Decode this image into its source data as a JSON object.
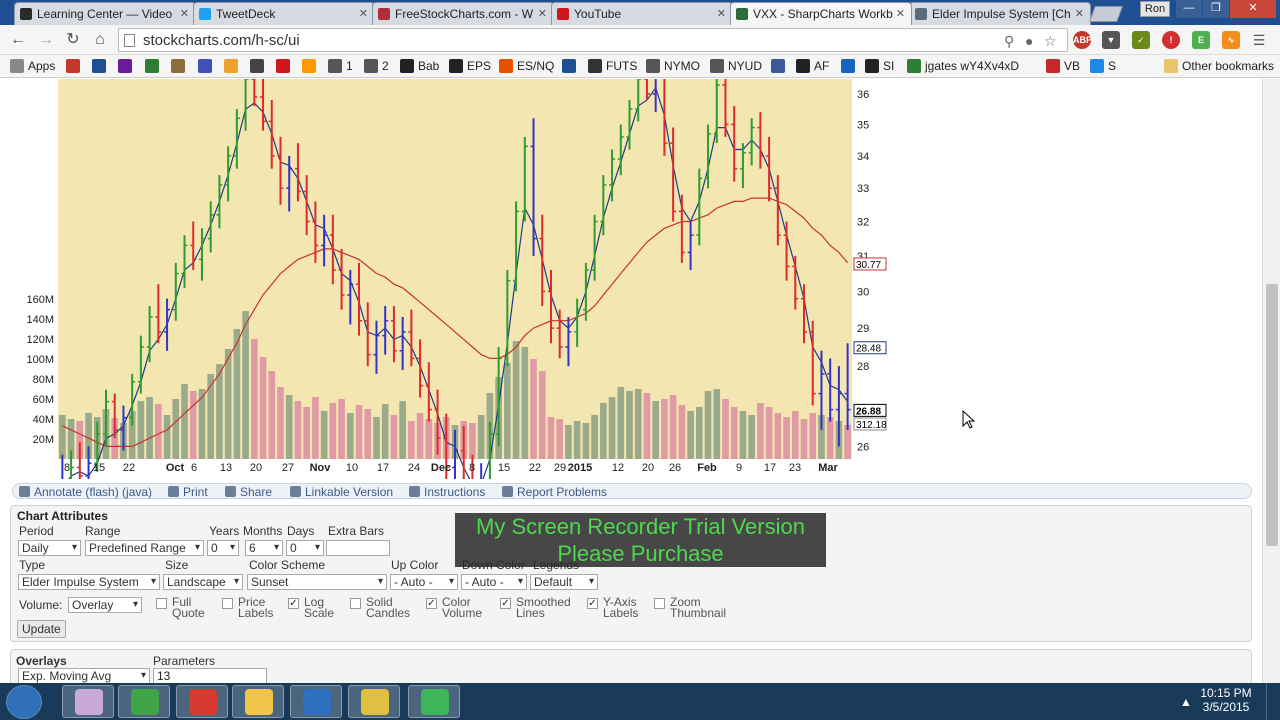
{
  "browser": {
    "tabs": [
      {
        "label": "Learning Center — Video",
        "color": "#2a2a2a"
      },
      {
        "label": "TweetDeck",
        "color": "#1da1f2"
      },
      {
        "label": "FreeStockCharts.com - W",
        "color": "#b0303a"
      },
      {
        "label": "YouTube",
        "color": "#cc181e"
      },
      {
        "label": "VXX - SharpCharts Workb",
        "color": "#2e6b3a"
      },
      {
        "label": "Elder Impulse System [Ch",
        "color": "#5a6b7a"
      }
    ],
    "active_tab": 4,
    "profile": "Ron",
    "url": "stockcharts.com/h-sc/ui"
  },
  "bookmarks": [
    {
      "label": "Apps",
      "color": "#888888"
    },
    {
      "label": "",
      "color": "#c0392b"
    },
    {
      "label": "",
      "color": "#1d4f91"
    },
    {
      "label": "",
      "color": "#6a1b9a"
    },
    {
      "label": "",
      "color": "#2e7d32"
    },
    {
      "label": "",
      "color": "#8a6d3b"
    },
    {
      "label": "",
      "color": "#3f51b5"
    },
    {
      "label": "",
      "color": "#f0a030"
    },
    {
      "label": "",
      "color": "#444444"
    },
    {
      "label": "",
      "color": "#cc181e"
    },
    {
      "label": "",
      "color": "#ff9800"
    },
    {
      "label": "1",
      "color": "#555555"
    },
    {
      "label": "2",
      "color": "#555555"
    },
    {
      "label": "Bab",
      "color": "#222222"
    },
    {
      "label": "EPS",
      "color": "#222222"
    },
    {
      "label": "ES/NQ",
      "color": "#e65100"
    },
    {
      "label": "",
      "color": "#1d4f91"
    },
    {
      "label": "FUTS",
      "color": "#333333"
    },
    {
      "label": "NYMO",
      "color": "#555555"
    },
    {
      "label": "NYUD",
      "color": "#555555"
    },
    {
      "label": "",
      "color": "#3b5998"
    },
    {
      "label": "AF",
      "color": "#222222"
    },
    {
      "label": "",
      "color": "#1565c0"
    },
    {
      "label": "SI",
      "color": "#222222"
    },
    {
      "label": "jgates wY4Xv4xD",
      "color": "#2e7d32"
    },
    {
      "label": "VB",
      "color": "#c62828"
    },
    {
      "label": "S",
      "color": "#1e88e5"
    }
  ],
  "other_bookmarks": "Other bookmarks",
  "chart_data": {
    "type": "bar",
    "style": "OHLC bars (Elder Impulse) with EMA overlays and volume",
    "x_ticks": [
      "8",
      "15",
      "22",
      "Oct",
      "6",
      "13",
      "20",
      "27",
      "Nov",
      "10",
      "17",
      "24",
      "Dec",
      "8",
      "15",
      "22",
      "29",
      "2015",
      "12",
      "20",
      "26",
      "Feb",
      "9",
      "17",
      "23",
      "Mar"
    ],
    "y_ticks_price": [
      "36",
      "35",
      "34",
      "33",
      "32",
      "31",
      "30",
      "29",
      "28",
      "26"
    ],
    "y_ticks_volume": [
      "160M",
      "140M",
      "120M",
      "100M",
      "80M",
      "60M",
      "40M",
      "20M"
    ],
    "y_scale": "log",
    "last_labels": [
      "30.77",
      "28.48",
      "26.88",
      "312.18"
    ],
    "colors": {
      "up": "#2e9d2e",
      "down": "#dd2a2a",
      "neutral": "#3333cc",
      "ema_fast": "#1f3a8a",
      "ema_slow": "#c83232",
      "vol_up": "#9aaa8a",
      "vol_down": "#e09aa6"
    },
    "background": "#f3e6b0",
    "ohlc": [
      [
        24.8,
        25.8,
        24.3,
        25.2,
        "b"
      ],
      [
        25.2,
        25.9,
        24.9,
        25.5,
        "g"
      ],
      [
        25.5,
        26.1,
        25.0,
        25.3,
        "r"
      ],
      [
        25.3,
        26.0,
        24.9,
        25.6,
        "b"
      ],
      [
        25.6,
        26.6,
        25.4,
        26.3,
        "g"
      ],
      [
        26.3,
        27.4,
        26.0,
        27.1,
        "g"
      ],
      [
        27.1,
        27.3,
        26.2,
        26.4,
        "r"
      ],
      [
        26.4,
        27.0,
        25.9,
        26.7,
        "b"
      ],
      [
        26.7,
        27.8,
        26.5,
        27.6,
        "g"
      ],
      [
        27.6,
        28.8,
        27.3,
        28.5,
        "g"
      ],
      [
        28.5,
        29.6,
        28.1,
        29.3,
        "g"
      ],
      [
        29.3,
        30.2,
        28.6,
        28.9,
        "r"
      ],
      [
        28.9,
        29.8,
        28.4,
        29.5,
        "b"
      ],
      [
        29.5,
        30.8,
        29.2,
        30.5,
        "g"
      ],
      [
        30.5,
        31.6,
        30.1,
        31.3,
        "g"
      ],
      [
        31.3,
        32.0,
        30.6,
        30.9,
        "r"
      ],
      [
        30.9,
        31.8,
        30.3,
        31.5,
        "g"
      ],
      [
        31.5,
        32.6,
        31.1,
        32.2,
        "g"
      ],
      [
        32.2,
        33.4,
        31.8,
        33.1,
        "g"
      ],
      [
        33.1,
        34.3,
        32.6,
        34.0,
        "g"
      ],
      [
        34.0,
        35.5,
        33.6,
        35.2,
        "g"
      ],
      [
        35.2,
        36.8,
        34.8,
        36.5,
        "g"
      ],
      [
        36.5,
        37.2,
        35.6,
        35.9,
        "r"
      ],
      [
        35.9,
        36.6,
        34.8,
        35.1,
        "r"
      ],
      [
        35.1,
        35.8,
        33.6,
        34.0,
        "r"
      ],
      [
        34.0,
        34.6,
        32.5,
        33.0,
        "r"
      ],
      [
        33.0,
        34.0,
        32.3,
        33.6,
        "b"
      ],
      [
        33.6,
        34.4,
        32.6,
        32.9,
        "r"
      ],
      [
        32.9,
        33.4,
        31.6,
        32.0,
        "r"
      ],
      [
        32.0,
        32.6,
        30.8,
        31.3,
        "r"
      ],
      [
        31.3,
        32.2,
        30.7,
        31.6,
        "b"
      ],
      [
        31.6,
        32.2,
        30.2,
        30.6,
        "r"
      ],
      [
        30.6,
        31.2,
        29.5,
        29.9,
        "r"
      ],
      [
        29.9,
        30.6,
        29.1,
        30.2,
        "b"
      ],
      [
        30.2,
        30.8,
        28.8,
        29.2,
        "r"
      ],
      [
        29.2,
        29.7,
        28.0,
        28.3,
        "r"
      ],
      [
        28.3,
        29.2,
        27.8,
        28.8,
        "b"
      ],
      [
        28.8,
        29.6,
        28.3,
        29.2,
        "b"
      ],
      [
        29.2,
        29.6,
        28.1,
        28.4,
        "r"
      ],
      [
        28.4,
        29.3,
        27.9,
        28.9,
        "b"
      ],
      [
        28.9,
        29.5,
        28.0,
        28.2,
        "r"
      ],
      [
        28.2,
        28.7,
        27.2,
        27.5,
        "r"
      ],
      [
        27.5,
        28.1,
        26.6,
        26.9,
        "r"
      ],
      [
        26.9,
        27.4,
        25.8,
        26.2,
        "r"
      ],
      [
        26.2,
        26.8,
        25.2,
        25.5,
        "r"
      ],
      [
        25.5,
        26.4,
        25.0,
        25.9,
        "b"
      ],
      [
        25.9,
        26.5,
        24.8,
        25.1,
        "r"
      ],
      [
        25.1,
        25.8,
        24.3,
        24.7,
        "r"
      ],
      [
        24.7,
        25.6,
        24.0,
        25.2,
        "b"
      ],
      [
        25.2,
        26.6,
        25.0,
        26.3,
        "g"
      ],
      [
        26.3,
        28.5,
        26.0,
        28.2,
        "g"
      ],
      [
        28.2,
        30.6,
        28.0,
        30.3,
        "g"
      ],
      [
        30.3,
        32.6,
        30.0,
        32.3,
        "g"
      ],
      [
        32.3,
        34.6,
        32.0,
        34.3,
        "g"
      ],
      [
        34.3,
        35.2,
        31.0,
        31.5,
        "b"
      ],
      [
        31.5,
        32.2,
        29.6,
        30.0,
        "r"
      ],
      [
        30.0,
        30.6,
        28.6,
        29.0,
        "r"
      ],
      [
        29.0,
        29.5,
        28.2,
        28.5,
        "r"
      ],
      [
        28.5,
        29.3,
        28.0,
        28.9,
        "b"
      ],
      [
        28.9,
        29.8,
        28.5,
        29.5,
        "g"
      ],
      [
        29.5,
        30.8,
        29.2,
        30.6,
        "g"
      ],
      [
        30.6,
        32.2,
        30.3,
        32.0,
        "g"
      ],
      [
        32.0,
        33.4,
        31.6,
        33.1,
        "g"
      ],
      [
        33.1,
        34.2,
        32.6,
        33.9,
        "g"
      ],
      [
        33.9,
        35.0,
        33.4,
        34.6,
        "g"
      ],
      [
        34.6,
        35.8,
        34.2,
        35.5,
        "g"
      ],
      [
        35.5,
        36.8,
        35.1,
        36.5,
        "g"
      ],
      [
        36.5,
        37.6,
        35.8,
        36.0,
        "r"
      ],
      [
        36.0,
        37.0,
        35.4,
        36.6,
        "b"
      ],
      [
        36.6,
        37.2,
        34.0,
        34.4,
        "r"
      ],
      [
        34.4,
        34.9,
        32.0,
        32.3,
        "r"
      ],
      [
        32.3,
        32.8,
        30.8,
        31.1,
        "r"
      ],
      [
        31.1,
        32.0,
        30.6,
        31.6,
        "b"
      ],
      [
        31.6,
        33.6,
        31.3,
        33.3,
        "g"
      ],
      [
        33.3,
        35.0,
        33.0,
        34.7,
        "g"
      ],
      [
        34.7,
        36.6,
        34.4,
        36.3,
        "g"
      ],
      [
        36.3,
        37.2,
        34.6,
        35.0,
        "r"
      ],
      [
        35.0,
        35.6,
        33.2,
        33.6,
        "r"
      ],
      [
        33.6,
        34.4,
        33.0,
        34.1,
        "g"
      ],
      [
        34.1,
        35.2,
        33.7,
        34.9,
        "g"
      ],
      [
        34.9,
        35.4,
        33.6,
        34.0,
        "r"
      ],
      [
        34.0,
        34.6,
        32.6,
        33.0,
        "r"
      ],
      [
        33.0,
        33.4,
        31.3,
        31.6,
        "r"
      ],
      [
        31.6,
        32.0,
        30.3,
        30.7,
        "r"
      ],
      [
        30.7,
        31.0,
        29.5,
        29.8,
        "r"
      ],
      [
        29.8,
        30.2,
        28.6,
        28.9,
        "r"
      ],
      [
        28.9,
        29.2,
        27.0,
        27.3,
        "r"
      ],
      [
        27.3,
        28.4,
        26.4,
        27.8,
        "b"
      ],
      [
        27.8,
        28.2,
        26.6,
        26.9,
        "b"
      ],
      [
        26.9,
        28.0,
        26.0,
        27.3,
        "b"
      ],
      [
        27.3,
        28.6,
        26.4,
        26.9,
        "b"
      ]
    ],
    "volume": [
      44,
      40,
      38,
      46,
      42,
      50,
      41,
      36,
      48,
      58,
      62,
      55,
      44,
      60,
      75,
      68,
      70,
      85,
      95,
      110,
      130,
      148,
      120,
      102,
      88,
      72,
      64,
      58,
      52,
      62,
      48,
      56,
      60,
      46,
      54,
      50,
      42,
      55,
      44,
      58,
      38,
      46,
      40,
      36,
      42,
      34,
      38,
      36,
      44,
      66,
      82,
      96,
      118,
      112,
      100,
      88,
      42,
      40,
      34,
      38,
      36,
      44,
      56,
      62,
      72,
      68,
      70,
      66,
      58,
      60,
      64,
      54,
      48,
      52,
      68,
      70,
      60,
      52,
      48,
      44,
      56,
      52,
      46,
      42,
      48,
      40,
      46,
      44,
      42,
      38,
      34
    ],
    "ema_fast": [
      25.0,
      25.3,
      25.4,
      25.3,
      25.6,
      26.2,
      26.3,
      26.5,
      27.0,
      27.6,
      28.4,
      28.7,
      29.1,
      29.8,
      30.6,
      30.8,
      31.3,
      31.9,
      32.6,
      33.4,
      34.4,
      35.5,
      35.7,
      35.4,
      34.7,
      33.8,
      33.7,
      33.3,
      32.6,
      31.9,
      31.8,
      31.2,
      30.5,
      30.3,
      29.7,
      28.9,
      28.8,
      29.0,
      28.7,
      28.8,
      28.5,
      28.0,
      27.4,
      26.8,
      26.1,
      26.0,
      25.5,
      25.1,
      25.1,
      25.7,
      27.0,
      28.6,
      30.5,
      32.4,
      31.9,
      30.9,
      29.9,
      29.2,
      29.0,
      29.3,
      30.0,
      31.0,
      32.1,
      33.0,
      33.8,
      34.7,
      35.6,
      35.8,
      36.2,
      35.3,
      33.7,
      32.4,
      32.0,
      32.6,
      33.6,
      34.9,
      34.9,
      34.2,
      34.2,
      34.5,
      34.2,
      33.6,
      32.6,
      31.6,
      30.7,
      29.8,
      28.5,
      28.1,
      27.5,
      27.4,
      27.1
    ],
    "ema_slow": [
      26.5,
      26.4,
      26.3,
      26.2,
      26.1,
      26.0,
      26.0,
      26.0,
      26.0,
      26.1,
      26.2,
      26.3,
      26.4,
      26.6,
      26.8,
      27.0,
      27.2,
      27.5,
      27.8,
      28.2,
      28.6,
      29.1,
      29.5,
      29.9,
      30.2,
      30.5,
      30.7,
      30.9,
      31.0,
      31.1,
      31.2,
      31.2,
      31.1,
      31.0,
      30.9,
      30.7,
      30.5,
      30.4,
      30.2,
      30.1,
      29.9,
      29.7,
      29.5,
      29.3,
      29.1,
      28.9,
      28.7,
      28.5,
      28.3,
      28.2,
      28.2,
      28.3,
      28.5,
      28.8,
      29.0,
      29.1,
      29.2,
      29.2,
      29.2,
      29.3,
      29.4,
      29.6,
      29.9,
      30.2,
      30.5,
      30.8,
      31.1,
      31.4,
      31.6,
      31.8,
      31.9,
      32.0,
      32.0,
      32.1,
      32.2,
      32.4,
      32.5,
      32.6,
      32.6,
      32.7,
      32.7,
      32.7,
      32.6,
      32.5,
      32.3,
      32.1,
      31.8,
      31.6,
      31.3,
      31.1,
      30.8
    ]
  },
  "actions": [
    {
      "label": "Annotate (flash) (java)",
      "icon": "pencil-icon"
    },
    {
      "label": "Print",
      "icon": "printer-icon"
    },
    {
      "label": "Share",
      "icon": "share-icon"
    },
    {
      "label": "Linkable Version",
      "icon": "bookmark-icon"
    },
    {
      "label": "Instructions",
      "icon": "info-icon"
    },
    {
      "label": "Report Problems",
      "icon": "help-icon"
    }
  ],
  "attrs": {
    "title": "Chart Attributes",
    "labels": {
      "period": "Period",
      "range": "Range",
      "years": "Years",
      "months": "Months",
      "days": "Days",
      "extra_bars": "Extra Bars",
      "type": "Type",
      "size": "Size",
      "color_scheme": "Color Scheme",
      "up_color": "Up Color",
      "down_color": "Down Color",
      "legends": "Legends",
      "volume": "Volume:"
    },
    "values": {
      "period": "Daily",
      "range": "Predefined Range",
      "years": "0",
      "months": "6",
      "days": "0",
      "extra_bars": "",
      "type": "Elder Impulse System",
      "size": "Landscape",
      "color_scheme": "Sunset",
      "up_color": "- Auto -",
      "down_color": "- Auto -",
      "legends": "Default",
      "volume": "Overlay"
    },
    "checkboxes": [
      {
        "line1": "Full",
        "line2": "Quote",
        "checked": ""
      },
      {
        "line1": "Price",
        "line2": "Labels",
        "checked": ""
      },
      {
        "line1": "Log",
        "line2": "Scale",
        "checked": "✓"
      },
      {
        "line1": "Solid",
        "line2": "Candles",
        "checked": ""
      },
      {
        "line1": "Color",
        "line2": "Volume",
        "checked": "✓"
      },
      {
        "line1": "Smoothed",
        "line2": "Lines",
        "checked": "✓"
      },
      {
        "line1": "Y-Axis",
        "line2": "Labels",
        "checked": "✓"
      },
      {
        "line1": "Zoom",
        "line2": "Thumbnail",
        "checked": ""
      }
    ],
    "update": "Update"
  },
  "watermark": {
    "line1": "My Screen Recorder Trial Version",
    "line2": "Please Purchase"
  },
  "overlays": {
    "title": "Overlays",
    "params_label": "Parameters",
    "type": "Exp. Moving Avg",
    "params": "13"
  },
  "taskbar": {
    "apps": [
      {
        "name": "paint-icon",
        "color": "#c9a9d8"
      },
      {
        "name": "utorrent-icon",
        "color": "#3fa447"
      },
      {
        "name": "puzzle-icon",
        "color": "#d63a2e"
      },
      {
        "name": "folder-icon",
        "color": "#f0c64a"
      },
      {
        "name": "bluetooth-icon",
        "color": "#2f6fc0"
      },
      {
        "name": "chrome-icon",
        "color": "#e0c040"
      },
      {
        "name": "recorder-icon",
        "color": "#3fb55a"
      }
    ],
    "time": "10:15 PM",
    "date": "3/5/2015"
  }
}
